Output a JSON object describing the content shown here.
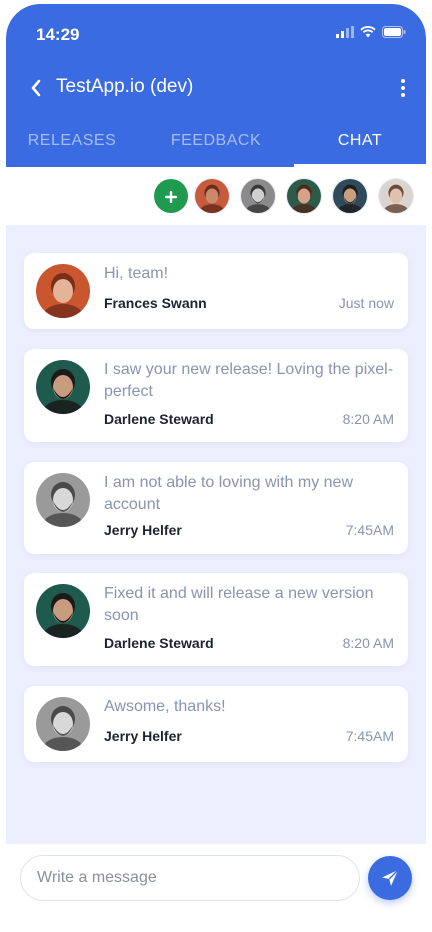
{
  "status_bar": {
    "time": "14:29"
  },
  "app_bar": {
    "title": "TestApp.io (dev)"
  },
  "tabs": [
    {
      "label": "RELEASES",
      "active": false
    },
    {
      "label": "FEEDBACK",
      "active": false
    },
    {
      "label": "CHAT",
      "active": true
    }
  ],
  "participants": [
    {
      "name": "participant-1",
      "skin": "#c98a6a",
      "hair": "#6b2e1c",
      "bg": "#c75b3c"
    },
    {
      "name": "participant-2",
      "skin": "#cfcfcf",
      "hair": "#3a3a3a",
      "bg": "#8a8a8a"
    },
    {
      "name": "participant-3",
      "skin": "#d8a288",
      "hair": "#4a2a1c",
      "bg": "#2e5a4a"
    },
    {
      "name": "participant-4",
      "skin": "#c8a080",
      "hair": "#1e1e1e",
      "bg": "#2f4a5a"
    },
    {
      "name": "participant-5",
      "skin": "#e0c0b0",
      "hair": "#6a4a3a",
      "bg": "#d9d4d0"
    }
  ],
  "messages": [
    {
      "text": "Hi, team!",
      "sender": "Frances Swann",
      "time": "Just now",
      "avatar": "frances"
    },
    {
      "text": "I saw your new release! Loving the pixel-perfect",
      "sender": "Darlene Steward",
      "time": "8:20 AM",
      "avatar": "darlene"
    },
    {
      "text": "I am not able to loving with my new account",
      "sender": "Jerry Helfer",
      "time": "7:45AM",
      "avatar": "jerry"
    },
    {
      "text": "Fixed it and will release a new version soon",
      "sender": "Darlene Steward",
      "time": "8:20 AM",
      "avatar": "darlene"
    },
    {
      "text": "Awsome, thanks!",
      "sender": "Jerry Helfer",
      "time": "7:45AM",
      "avatar": "jerry"
    }
  ],
  "composer": {
    "placeholder": "Write a message"
  },
  "colors": {
    "primary": "#3b6be0",
    "add_button": "#1f9a4e",
    "chat_background": "#ebefff",
    "message_text": "#8a93b0",
    "sender_text": "#1e2233"
  },
  "icons": {
    "back": "chevron-left-icon",
    "menu": "more-vertical-icon",
    "add": "plus-icon",
    "send": "send-icon"
  }
}
